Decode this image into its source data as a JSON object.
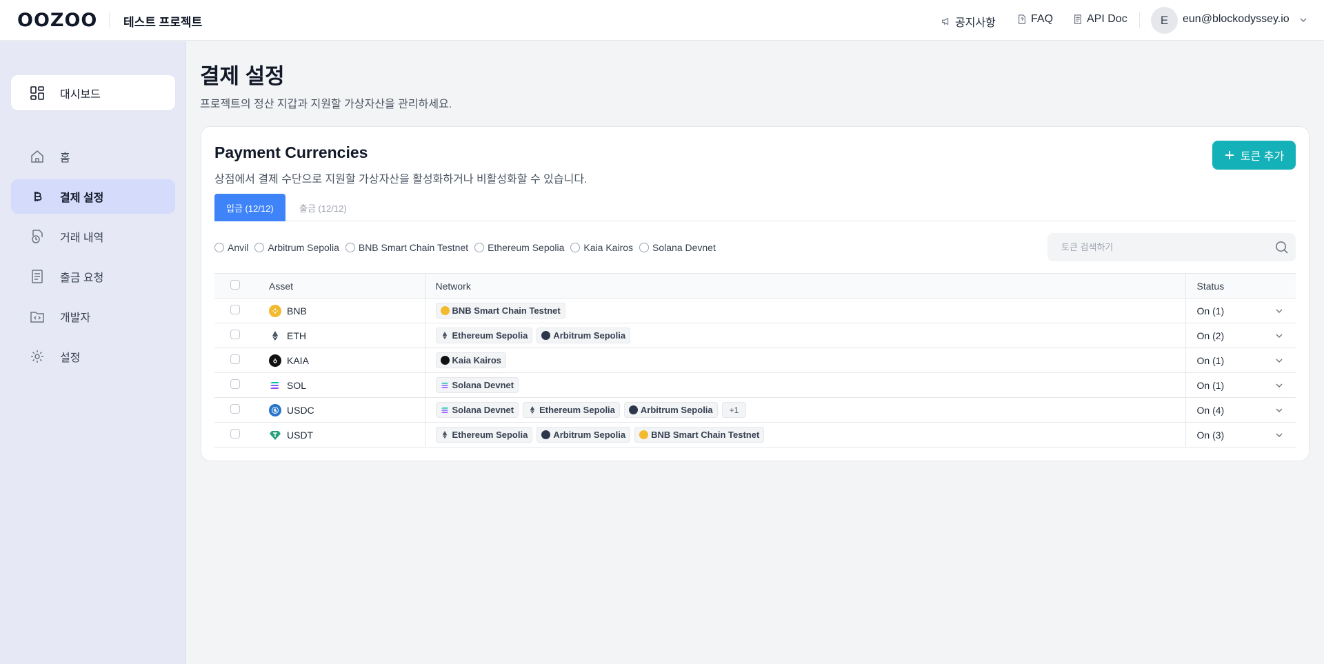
{
  "header": {
    "logo": "OOZOO",
    "project_name": "테스트 프로젝트",
    "links": {
      "notice": "공지사항",
      "faq": "FAQ",
      "api_doc": "API Doc"
    },
    "user": {
      "avatar_initial": "E",
      "email": "eun@blockodyssey.io"
    }
  },
  "sidebar": {
    "dashboard_label": "대시보드",
    "items": [
      {
        "label": "홈",
        "icon": "home-icon",
        "active": false
      },
      {
        "label": "결제 설정",
        "icon": "bitcoin-icon",
        "active": true
      },
      {
        "label": "거래 내역",
        "icon": "history-icon",
        "active": false
      },
      {
        "label": "출금 요청",
        "icon": "document-icon",
        "active": false
      },
      {
        "label": "개발자",
        "icon": "code-folder-icon",
        "active": false
      },
      {
        "label": "설정",
        "icon": "gear-icon",
        "active": false
      }
    ]
  },
  "page": {
    "title": "결제 설정",
    "subtitle": "프로젝트의 정산 지갑과 지원할 가상자산을 관리하세요."
  },
  "card": {
    "title": "Payment Currencies",
    "subtitle": "상점에서 결제 수단으로 지원할 가상자산을 활성화하거나 비활성화할 수 있습니다.",
    "add_button": "토큰 추가",
    "tabs": {
      "deposit": "입금 (12/12)",
      "withdraw": "출금 (12/12)"
    },
    "filters": [
      "Anvil",
      "Arbitrum Sepolia",
      "BNB Smart Chain Testnet",
      "Ethereum Sepolia",
      "Kaia Kairos",
      "Solana Devnet"
    ],
    "search_placeholder": "토큰 검색하기",
    "columns": {
      "asset": "Asset",
      "network": "Network",
      "status": "Status"
    },
    "rows": [
      {
        "asset": "BNB",
        "networks": [
          "BNB Smart Chain Testnet"
        ],
        "status": "On (1)"
      },
      {
        "asset": "ETH",
        "networks": [
          "Ethereum Sepolia",
          "Arbitrum Sepolia"
        ],
        "status": "On (2)"
      },
      {
        "asset": "KAIA",
        "networks": [
          "Kaia Kairos"
        ],
        "status": "On (1)"
      },
      {
        "asset": "SOL",
        "networks": [
          "Solana Devnet"
        ],
        "status": "On (1)"
      },
      {
        "asset": "USDC",
        "networks": [
          "Solana Devnet",
          "Ethereum Sepolia",
          "Arbitrum Sepolia"
        ],
        "more": "+1",
        "status": "On (4)"
      },
      {
        "asset": "USDT",
        "networks": [
          "Ethereum Sepolia",
          "Arbitrum Sepolia",
          "BNB Smart Chain Testnet"
        ],
        "status": "On (3)"
      }
    ]
  },
  "colors": {
    "accent": "#14b1b8",
    "tab_active": "#3f83f8",
    "sidebar_bg": "#e7e8f5",
    "sidebar_active": "#d4dbfb",
    "bnb": "#f3ba2f",
    "usdc": "#2775ca",
    "usdt": "#26a17b"
  }
}
